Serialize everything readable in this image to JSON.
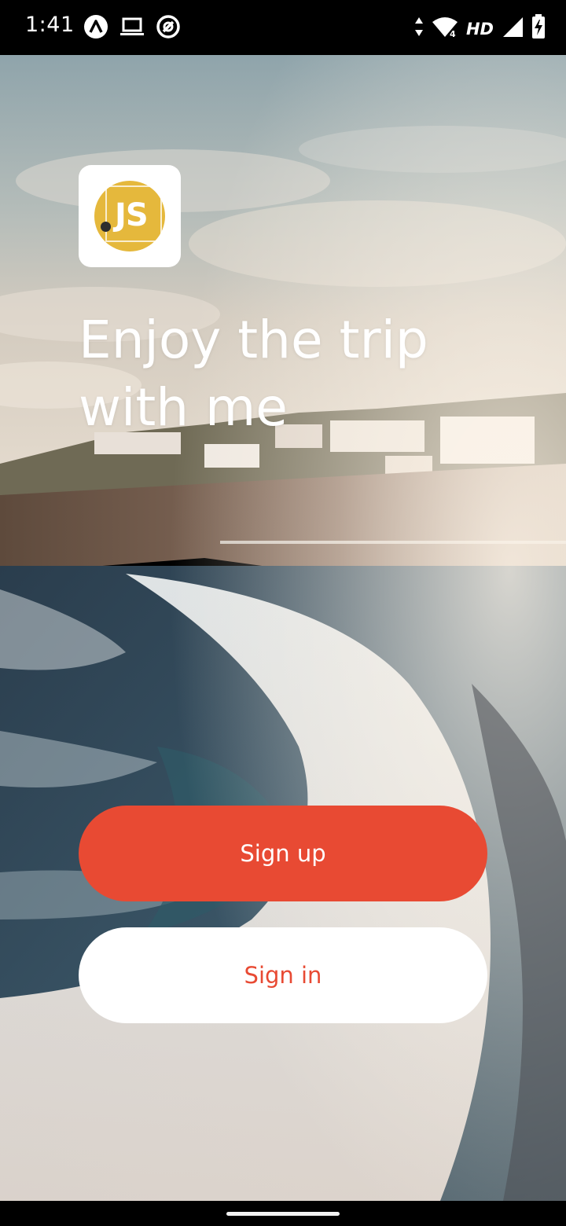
{
  "status_bar": {
    "time": "1:41",
    "network_label": "HD",
    "left_icons": [
      "app-a-icon",
      "laptop-icon",
      "no-entry-icon"
    ],
    "right_icons": [
      "data-arrows-icon",
      "wifi-icon",
      "signal-icon",
      "battery-charging-icon"
    ]
  },
  "app": {
    "logo_text": "JS",
    "headline": "Enjoy the trip with me"
  },
  "actions": {
    "signup_label": "Sign up",
    "signin_label": "Sign in"
  },
  "colors": {
    "accent": "#e84a33",
    "logo_yellow": "#e5b83c",
    "button_light": "#ffffff",
    "status_bar": "#000000"
  }
}
